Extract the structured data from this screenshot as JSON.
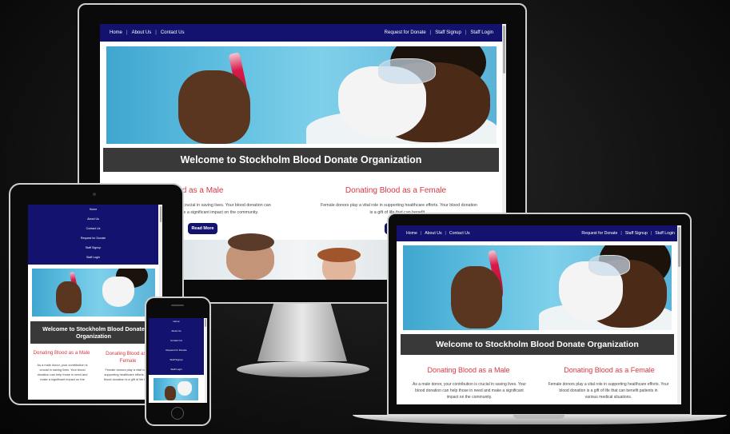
{
  "site": {
    "nav_left": [
      "Home",
      "About Us",
      "Contact Us"
    ],
    "nav_right": [
      "Request for Donate",
      "Staff Signup",
      "Staff Login"
    ],
    "welcome": "Welcome to Stockholm Blood Donate Organization",
    "male": {
      "title": "Donating Blood as a Male",
      "text_desktop": "As a male donor, your contribution is crucial in saving lives. Your blood donation can help those in need and make a significant impact on the community.",
      "text_desktop_visible_1": "...p is crucial in saving lives. Your blood donation can",
      "text_desktop_visible_2": "...make a significant impact on the community.",
      "text_laptop_1": "As a male donor, your contribution is crucial in saving lives. Your",
      "text_laptop_2": "blood donation can help those in need and make a significant",
      "text_laptop_3": "impact on the community.",
      "title_visible_desktop": "...g Blood as a Male",
      "tablet_text_1": "As a male donor, your contribution is",
      "tablet_text_2": "crucial in saving lives. Your blood",
      "tablet_text_3": "donation can help those in need and",
      "tablet_text_4": "make a significant impact on the"
    },
    "female": {
      "title": "Donating Blood as a Female",
      "text_desktop_1": "Female donors play a vital role in supporting healthcare efforts. Your blood donation",
      "text_desktop_2": "is a gift of life that can benefit...",
      "text_laptop_1": "Female donors play a vital role in supporting healthcare efforts. Your",
      "text_laptop_2": "blood donation is a gift of life that can benefit patients in",
      "text_laptop_3": "various medical situations.",
      "tablet_title_1": "Donating Blood as a",
      "tablet_title_2": "Female",
      "tablet_text_1": "Female donors play a vital role in",
      "tablet_text_2": "supporting healthcare efforts. Your",
      "tablet_text_3": "blood donation is a gift of life that..."
    },
    "read_more": "Read More",
    "mobile_menu": [
      "Home",
      "About Us",
      "Contact Us",
      "Request for Donate",
      "Staff Signup",
      "Staff Login"
    ]
  },
  "colors": {
    "nav": "#13126e",
    "welcome_bar": "#393939",
    "section_title": "#d8373f"
  }
}
